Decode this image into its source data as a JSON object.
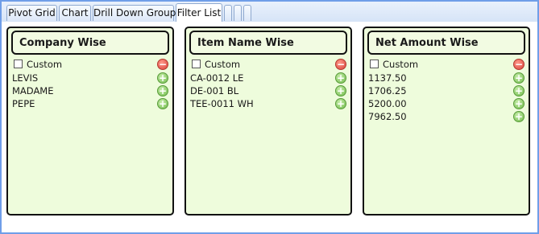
{
  "tabs": [
    {
      "label": "Pivot Grid",
      "active": false
    },
    {
      "label": "Chart",
      "active": false
    },
    {
      "label": "Drill Down Group",
      "active": false
    },
    {
      "label": "Filter List",
      "active": true
    }
  ],
  "panels": [
    {
      "title": "Company Wise",
      "custom_label": "Custom",
      "items": [
        "LEVIS",
        "MADAME",
        "PEPE"
      ]
    },
    {
      "title": "Item Name Wise",
      "custom_label": "Custom",
      "items": [
        "CA-0012 LE",
        "DE-001 BL",
        "TEE-0011 WH"
      ]
    },
    {
      "title": "Net Amount Wise",
      "custom_label": "Custom",
      "items": [
        "1137.50",
        "1706.25",
        "5200.00",
        "7962.50"
      ]
    }
  ],
  "icons": {
    "remove": "minus-circle-icon",
    "add": "plus-circle-icon"
  },
  "colors": {
    "panel_background": "#eefcdc",
    "window_border": "#6f9ee8",
    "add_button": "#6fba4a",
    "remove_button": "#d9413a"
  }
}
